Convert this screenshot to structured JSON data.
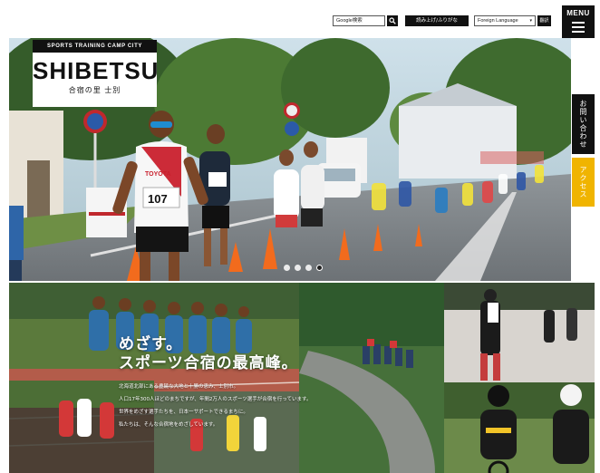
{
  "header": {
    "search_placeholder": "Google検索",
    "read_aloud_label": "読み上げ/ふりがな",
    "language_select_value": "Foreign Language",
    "language_go_label": "翻訳",
    "menu_label": "MENU"
  },
  "hero": {
    "logo_tagline": "SPORTS TRAINING CAMP CITY",
    "logo_name": "SHIBETSU",
    "logo_subtitle": "合宿の里 士別",
    "bib_number": "107",
    "bib_sponsor": "TOYOTA",
    "slides_total": 4,
    "slide_active": 4
  },
  "side_tabs": {
    "contact_label": "お問い合わせ",
    "access_label": "アクセス"
  },
  "intro": {
    "headline_1": "めざす。",
    "headline_2": "スポーツ合宿の最高峰。",
    "body_lines": [
      "北海道北部にある豊饒な大地と十勝の恵み、士別市。",
      "人口17年300人ほどのまちですが、年間2万人のスポーツ選手が合宿を行っています。",
      "世界をめざす選手たちを、日本一サポートできるまちに。",
      "私たちは、そんな合宿地をめざしています。"
    ]
  },
  "colors": {
    "accent_black": "#111111",
    "access_yellow": "#f0b400"
  }
}
